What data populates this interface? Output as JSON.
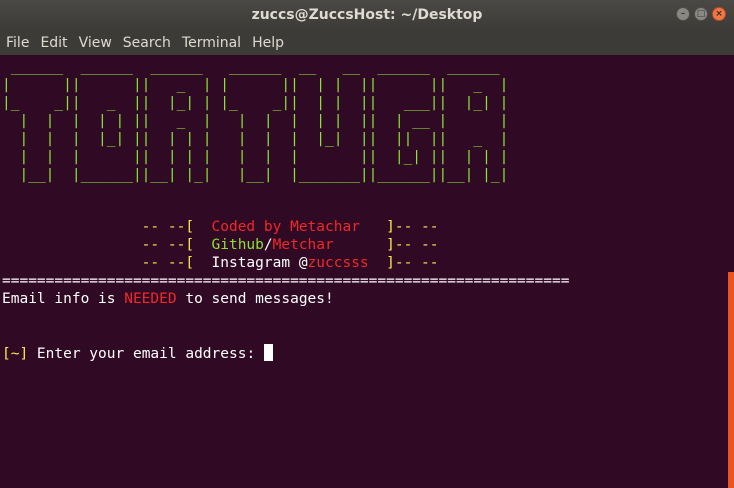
{
  "window": {
    "title": "zuccs@ZuccsHost: ~/Desktop"
  },
  "menu": [
    "File",
    "Edit",
    "View",
    "Search",
    "Terminal",
    "Help"
  ],
  "terminal": {
    "logo": " ______  ______  ______   ______  __   __  ______  ______\n|      ||      ||   _  | |      ||  | |  ||      ||   _  |\n|_    _||   _  ||  |_| | |_    _||  | |  ||   ___||  |_| |\n  |  |  |  | | ||   _  |   |  |  |  | |  ||  | __ |      |\n  |  |  |  |_| ||  | | |   |  |  |  |_|  ||  ||  ||   _  |\n  |  |  |      ||  | | |   |  |  |       ||  |_| ||  | | |\n  |__|  |______||__| |_|   |__|  |_______||______||__| |_|",
    "credits": [
      {
        "pre": "                -- --[  ",
        "a": "Coded by ",
        "b": "Metachar",
        "sep": "",
        "pad": "   ",
        "post": "]-- --"
      },
      {
        "pre": "                -- --[  ",
        "a": "Github",
        "sep": "/",
        "b": "Metchar",
        "pad": "      ",
        "post": "]-- --"
      },
      {
        "pre": "                -- --[  ",
        "a": "Instagram @",
        "b": "zuccsss",
        "sep": "",
        "pad": "  ",
        "post": "]-- --"
      }
    ],
    "divider": "=================================================================",
    "info": {
      "before": "Email info is ",
      "highlight": "NEEDED",
      "after": " to send messages!"
    },
    "prompt": {
      "marker": "[~]",
      "text": " Enter your email address: "
    }
  },
  "colors": {
    "title_bar": "#3c3b37",
    "terminal_bg": "#300a24",
    "logo": "#8ae234",
    "accent_red": "#ef2929",
    "accent_yellow": "#fce94f",
    "scroll_thumb": "#e95420"
  }
}
